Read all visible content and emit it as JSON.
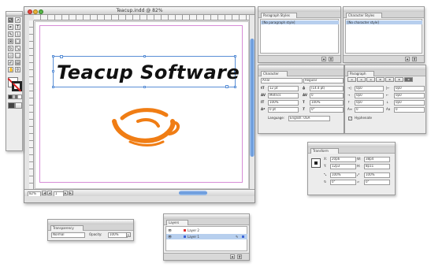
{
  "document_window": {
    "title": "Teacup.indd @ 82%",
    "zoom": "82%",
    "page_number": "1",
    "canvas_text": "Teacup Software",
    "colors": {
      "logo_orange": "#f07d14",
      "selection_blue": "#5a8fd6",
      "scroll_blue": "#7fa9dc"
    }
  },
  "toolbox": {
    "icons": [
      "selection-tool",
      "direct-selection-tool",
      "pen-tool",
      "type-tool",
      "pencil-tool",
      "line-tool",
      "rectangle-frame-tool",
      "rectangle-tool",
      "rotate-tool",
      "scale-tool",
      "shear-tool",
      "free-transform-tool",
      "eyedropper-tool",
      "gradient-tool",
      "hand-tool",
      "zoom-tool",
      "fill-stroke-swatch",
      "apply-none",
      "normal-view",
      "preview-view"
    ]
  },
  "panels": {
    "paragraph_styles": {
      "tab": "Paragraph Styles",
      "row": "[No paragraph style]"
    },
    "character_styles": {
      "tab": "Character Styles",
      "row": "[No character style]"
    },
    "character": {
      "tab": "Character",
      "font": "Arial",
      "style": "Regular",
      "size": "12 pt",
      "leading": "(14.4 pt)",
      "kerning": "Metrics",
      "tracking": "0",
      "vscale": "100%",
      "hscale": "100%",
      "baseline": "0 pt",
      "skew": "0°",
      "language_label": "Language:",
      "language": "English: USA"
    },
    "paragraph": {
      "tab": "Paragraph",
      "indent_left": "0p0",
      "indent_right": "0p0",
      "first_line": "0p0",
      "last_line": "0p0",
      "space_before": "0p0",
      "space_after": "0p0",
      "drop_lines": "0",
      "drop_chars": "0",
      "hyphenate_label": "Hyphenate"
    },
    "transform": {
      "tab": "Transform",
      "x": "20p6",
      "y": "12p3",
      "w": "38p4",
      "h": "8p11",
      "scale_x": "100%",
      "scale_y": "100%",
      "rotate": "0°",
      "shear": "0°"
    },
    "transparency": {
      "tab": "Transparency",
      "mode": "Normal",
      "opacity_label": "Opacity:",
      "opacity": "100%"
    },
    "layers": {
      "tab": "Layers",
      "items": [
        "Layer 2",
        "Layer 1"
      ]
    }
  }
}
